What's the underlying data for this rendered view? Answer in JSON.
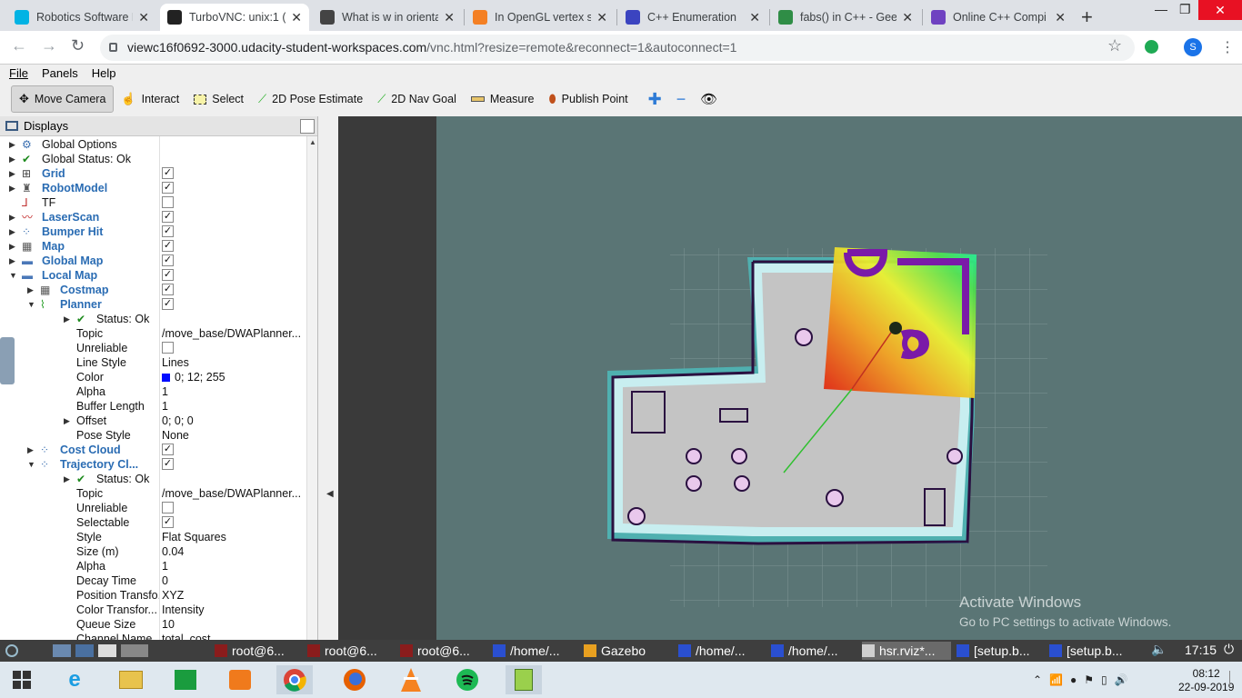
{
  "browser": {
    "tabs": [
      {
        "title": "Robotics Software E",
        "favicon": "udacity-icon",
        "color": "#02b3e4"
      },
      {
        "title": "TurboVNC: unix:1 ()",
        "favicon": "vnc-icon",
        "color": "#222222",
        "active": true
      },
      {
        "title": "What is w in orienta",
        "favicon": "grid-icon",
        "color": "#444444"
      },
      {
        "title": "In OpenGL vertex sh",
        "favicon": "stackoverflow-icon",
        "color": "#f48024"
      },
      {
        "title": "C++ Enumeration",
        "favicon": "programiz-icon",
        "color": "#3b44c0"
      },
      {
        "title": "fabs() in C++ - Gee",
        "favicon": "geeksforgeeks-icon",
        "color": "#2f8d46"
      },
      {
        "title": "Online C++ Compi",
        "favicon": "onlinegdb-icon",
        "color": "#6f42c1"
      }
    ],
    "url_host": "viewc16f0692-3000.udacity-student-workspaces.com",
    "url_path": "/vnc.html?resize=remote&reconnect=1&autoconnect=1",
    "profile_initial": "S"
  },
  "rviz": {
    "menu": [
      "File",
      "Panels",
      "Help"
    ],
    "tools": [
      {
        "label": "Move Camera",
        "icon": "move-camera-icon",
        "active": true
      },
      {
        "label": "Interact",
        "icon": "hand-icon"
      },
      {
        "label": "Select",
        "icon": "select-icon"
      },
      {
        "label": "2D Pose Estimate",
        "icon": "pose-arrow-icon"
      },
      {
        "label": "2D Nav Goal",
        "icon": "goal-arrow-icon"
      },
      {
        "label": "Measure",
        "icon": "ruler-icon"
      },
      {
        "label": "Publish Point",
        "icon": "pin-icon"
      }
    ],
    "displays_title": "Displays",
    "tree": [
      {
        "indent": 0,
        "arrow": "right",
        "icon": "gear-icon",
        "name": "Global Options",
        "bold": false
      },
      {
        "indent": 0,
        "arrow": "right",
        "icon": "check-icon",
        "name": "Global Status: Ok",
        "bold": false
      },
      {
        "indent": 0,
        "arrow": "right",
        "icon": "grid-icon",
        "name": "Grid",
        "bold": true,
        "check": true
      },
      {
        "indent": 0,
        "arrow": "right",
        "icon": "robot-icon",
        "name": "RobotModel",
        "bold": true,
        "check": true
      },
      {
        "indent": 0,
        "arrow": "",
        "icon": "tf-icon",
        "name": "TF",
        "bold": false,
        "check": false
      },
      {
        "indent": 0,
        "arrow": "right",
        "icon": "laser-icon",
        "name": "LaserScan",
        "bold": true,
        "check": true
      },
      {
        "indent": 0,
        "arrow": "right",
        "icon": "points-icon",
        "name": "Bumper Hit",
        "bold": true,
        "check": true
      },
      {
        "indent": 0,
        "arrow": "right",
        "icon": "map-icon",
        "name": "Map",
        "bold": true,
        "check": true
      },
      {
        "indent": 0,
        "arrow": "right",
        "icon": "folder-icon",
        "name": "Global Map",
        "bold": true,
        "check": true
      },
      {
        "indent": 0,
        "arrow": "down",
        "icon": "folder-icon",
        "name": "Local Map",
        "bold": true,
        "check": true
      },
      {
        "indent": 1,
        "arrow": "right",
        "icon": "map-icon",
        "name": "Costmap",
        "bold": true,
        "check": true
      },
      {
        "indent": 1,
        "arrow": "down",
        "icon": "path-icon",
        "name": "Planner",
        "bold": true,
        "check": true
      },
      {
        "indent": 2,
        "arrow": "right",
        "icon": "check-icon",
        "name": "Status: Ok",
        "bold": false
      },
      {
        "indent": 2,
        "arrow": "",
        "icon": "",
        "name": "Topic",
        "value": "/move_base/DWAPlanner..."
      },
      {
        "indent": 2,
        "arrow": "",
        "icon": "",
        "name": "Unreliable",
        "check": false
      },
      {
        "indent": 2,
        "arrow": "",
        "icon": "",
        "name": "Line Style",
        "value": "Lines"
      },
      {
        "indent": 2,
        "arrow": "",
        "icon": "",
        "name": "Color",
        "value": "0; 12; 255",
        "swatch": "#000cff"
      },
      {
        "indent": 2,
        "arrow": "",
        "icon": "",
        "name": "Alpha",
        "value": "1"
      },
      {
        "indent": 2,
        "arrow": "",
        "icon": "",
        "name": "Buffer Length",
        "value": "1"
      },
      {
        "indent": 2,
        "arrow": "right",
        "icon": "",
        "name": "Offset",
        "value": "0; 0; 0"
      },
      {
        "indent": 2,
        "arrow": "",
        "icon": "",
        "name": "Pose Style",
        "value": "None"
      },
      {
        "indent": 1,
        "arrow": "right",
        "icon": "points-icon",
        "name": "Cost Cloud",
        "bold": true,
        "check": true
      },
      {
        "indent": 1,
        "arrow": "down",
        "icon": "points-icon",
        "name": "Trajectory Cl...",
        "bold": true,
        "check": true
      },
      {
        "indent": 2,
        "arrow": "right",
        "icon": "check-icon",
        "name": "Status: Ok",
        "bold": false
      },
      {
        "indent": 2,
        "arrow": "",
        "icon": "",
        "name": "Topic",
        "value": "/move_base/DWAPlanner..."
      },
      {
        "indent": 2,
        "arrow": "",
        "icon": "",
        "name": "Unreliable",
        "check": false
      },
      {
        "indent": 2,
        "arrow": "",
        "icon": "",
        "name": "Selectable",
        "check": true
      },
      {
        "indent": 2,
        "arrow": "",
        "icon": "",
        "name": "Style",
        "value": "Flat Squares"
      },
      {
        "indent": 2,
        "arrow": "",
        "icon": "",
        "name": "Size (m)",
        "value": "0.04"
      },
      {
        "indent": 2,
        "arrow": "",
        "icon": "",
        "name": "Alpha",
        "value": "1"
      },
      {
        "indent": 2,
        "arrow": "",
        "icon": "",
        "name": "Decay Time",
        "value": "0"
      },
      {
        "indent": 2,
        "arrow": "",
        "icon": "",
        "name": "Position Transfo...",
        "value": "XYZ"
      },
      {
        "indent": 2,
        "arrow": "",
        "icon": "",
        "name": "Color Transfor...",
        "value": "Intensity"
      },
      {
        "indent": 2,
        "arrow": "",
        "icon": "",
        "name": "Queue Size",
        "value": "10"
      },
      {
        "indent": 2,
        "arrow": "",
        "icon": "",
        "name": "Channel Name",
        "value": "total_cost"
      }
    ],
    "watermark_title": "Activate Windows",
    "watermark_sub": "Go to PC settings to activate Windows."
  },
  "vnc_panel": {
    "tasks": [
      {
        "label": "root@6...",
        "icon": "terminal-icon"
      },
      {
        "label": "root@6...",
        "icon": "terminal-icon"
      },
      {
        "label": "root@6...",
        "icon": "terminal-icon"
      },
      {
        "label": "/home/...",
        "icon": "x-icon"
      },
      {
        "label": "Gazebo",
        "icon": "gazebo-icon"
      },
      {
        "label": "/home/...",
        "icon": "x-icon"
      },
      {
        "label": "/home/...",
        "icon": "x-icon"
      },
      {
        "label": "hsr.rviz*...",
        "icon": "rviz-icon",
        "active": true
      },
      {
        "label": "[setup.b...",
        "icon": "x-icon"
      },
      {
        "label": "[setup.b...",
        "icon": "x-icon"
      }
    ],
    "clock": "17:15"
  },
  "taskbar": {
    "apps": [
      "windows-start-icon",
      "internet-explorer-icon",
      "file-explorer-icon",
      "store-icon",
      "media-player-icon",
      "chrome-icon",
      "firefox-icon",
      "vlc-icon",
      "spotify-icon",
      "notepad-plus-icon"
    ],
    "time": "08:12",
    "date": "22-09-2019"
  }
}
